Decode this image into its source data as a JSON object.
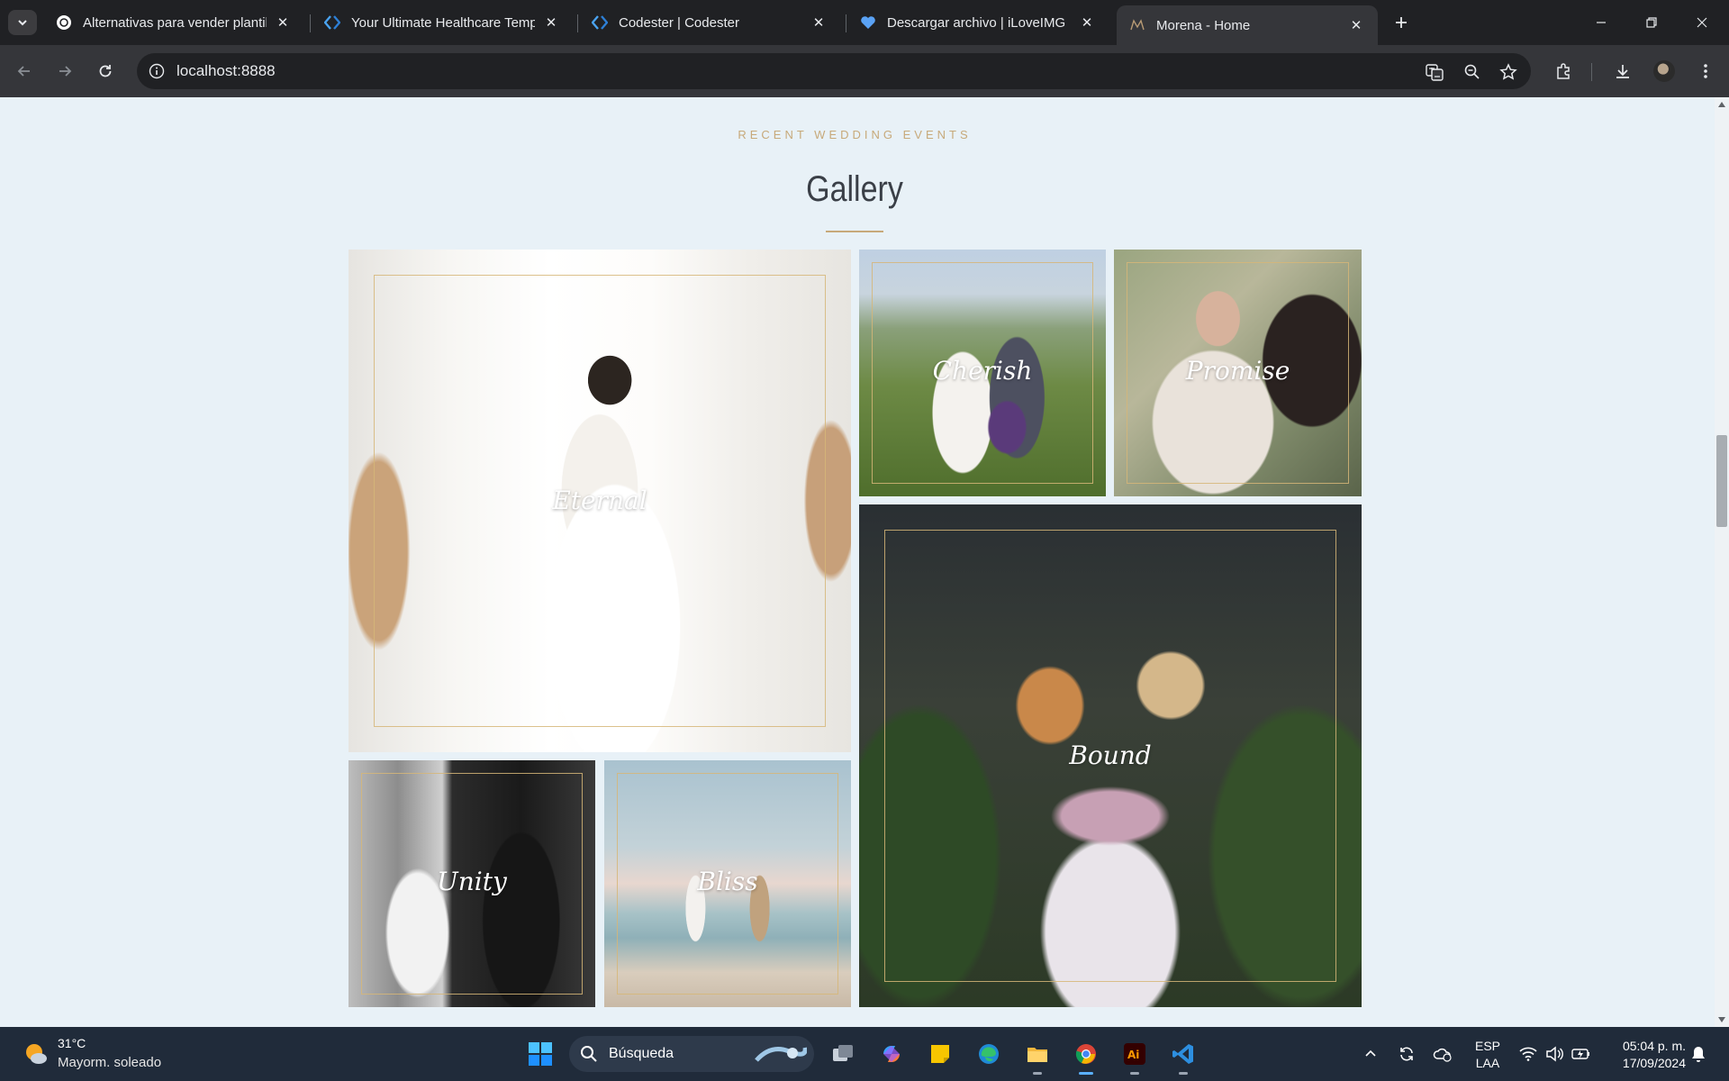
{
  "browser": {
    "tabs": [
      {
        "title": "Alternativas para vender plantilla",
        "active": false
      },
      {
        "title": "Your Ultimate Healthcare Templa",
        "active": false
      },
      {
        "title": "Codester | Codester",
        "active": false
      },
      {
        "title": "Descargar archivo | iLoveIMG",
        "active": false
      },
      {
        "title": "Morena - Home",
        "active": true
      }
    ],
    "address": "localhost:8888"
  },
  "page": {
    "eyebrow": "RECENT WEDDING EVENTS",
    "heading": "Gallery",
    "accent_color": "#c7a97a",
    "gallery": [
      {
        "caption": "Eternal"
      },
      {
        "caption": "Cherish"
      },
      {
        "caption": "Promise"
      },
      {
        "caption": "Bound"
      },
      {
        "caption": "Unity"
      },
      {
        "caption": "Bliss"
      }
    ]
  },
  "taskbar": {
    "weather_temp": "31°C",
    "weather_desc": "Mayorm. soleado",
    "search_placeholder": "Búsqueda",
    "lang_top": "ESP",
    "lang_bottom": "LAA",
    "time": "05:04 p. m.",
    "date": "17/09/2024"
  }
}
